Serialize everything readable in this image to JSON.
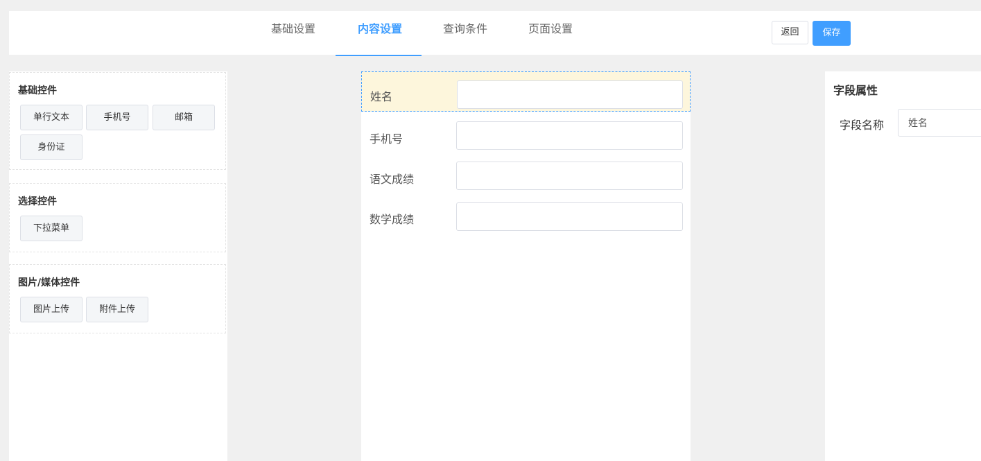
{
  "tabs": [
    {
      "label": "基础设置",
      "active": false
    },
    {
      "label": "内容设置",
      "active": true
    },
    {
      "label": "查询条件",
      "active": false
    },
    {
      "label": "页面设置",
      "active": false
    }
  ],
  "actions": {
    "back_label": "返回",
    "save_label": "保存"
  },
  "palette": {
    "groups": [
      {
        "title": "基础控件",
        "items": [
          "单行文本",
          "手机号",
          "邮箱",
          "身份证"
        ]
      },
      {
        "title": "选择控件",
        "items": [
          "下拉菜单"
        ]
      },
      {
        "title": "图片/媒体控件",
        "items": [
          "图片上传",
          "附件上传"
        ]
      }
    ]
  },
  "form": {
    "fields": [
      {
        "label": "姓名",
        "value": "",
        "selected": true
      },
      {
        "label": "手机号",
        "value": "",
        "selected": false
      },
      {
        "label": "语文成绩",
        "value": "",
        "selected": false
      },
      {
        "label": "数学成绩",
        "value": "",
        "selected": false
      }
    ]
  },
  "properties": {
    "title": "字段属性",
    "field_name_label": "字段名称",
    "field_name_value": "姓名"
  },
  "colors": {
    "accent": "#409eff",
    "selected_bg": "#fdf6dc",
    "page_bg": "#f0f0f0"
  }
}
